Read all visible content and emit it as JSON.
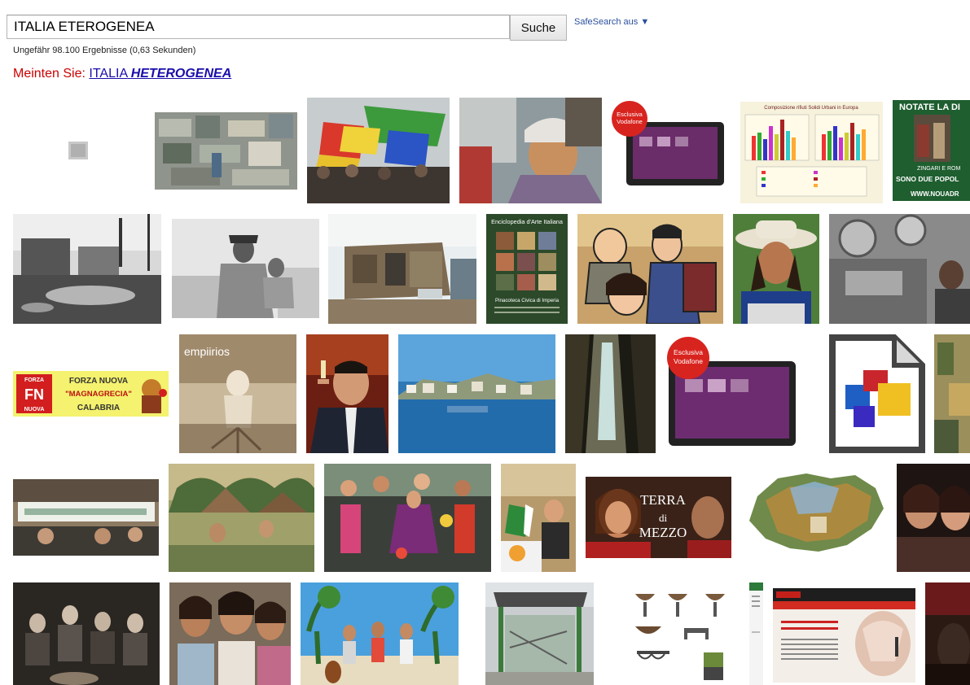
{
  "search": {
    "query": "ITALIA ETEROGENEA",
    "button_label": "Suche",
    "safesearch_label": "SafeSearch aus ▼"
  },
  "results": {
    "stats": "Ungefähr 98.100 Ergebnisse (0,63 Sekunden)"
  },
  "did_you_mean": {
    "prefix": "Meinten Sie:",
    "plain": "ITALIA",
    "bold": "HETEROGENEA"
  },
  "thumb_text": {
    "vodafone_badge_1": "Esclusiva",
    "vodafone_badge_2": "Vodafone",
    "rifiuti_title": "Composizione rifiuti Solidi Urbani in Europa",
    "notate_title": "NOTATE LA DI",
    "notate_sub1": "ZINGARI E ROM",
    "notate_sub2": "SONO DUE POPOL",
    "notate_url": "WWW.NOUADR",
    "enciclopedia_title": "Enciclopedia d'Arte Italiana",
    "pinacoteca": "Pinacoteca Civica di Imperia",
    "forza_nuova": "FORZA NUOVA",
    "magnagrecia": "\"MAGNAGRECIA\"",
    "calabria": "CALABRIA",
    "fn_top": "FORZA",
    "fn_mid": "FN",
    "fn_bot": "NUOVA",
    "empiirios": "empiirios",
    "terra_1": "TERRA",
    "terra_2": "di",
    "terra_3": "MEZZO"
  }
}
